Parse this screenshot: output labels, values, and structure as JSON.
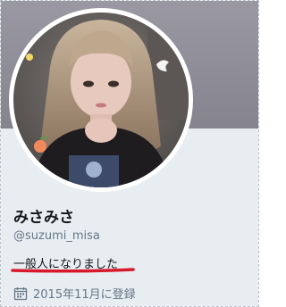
{
  "profile": {
    "display_name": "みさみさ",
    "handle": "@suzumi_misa",
    "bio": "一般人になりました",
    "joined": "2015年11月に登録"
  },
  "icons": {
    "calendar": "calendar-icon"
  },
  "colors": {
    "banner": "#8e8d96",
    "profile_bg": "#e8edf2",
    "bio_underline": "#d7192b",
    "secondary_text": "#657786"
  }
}
